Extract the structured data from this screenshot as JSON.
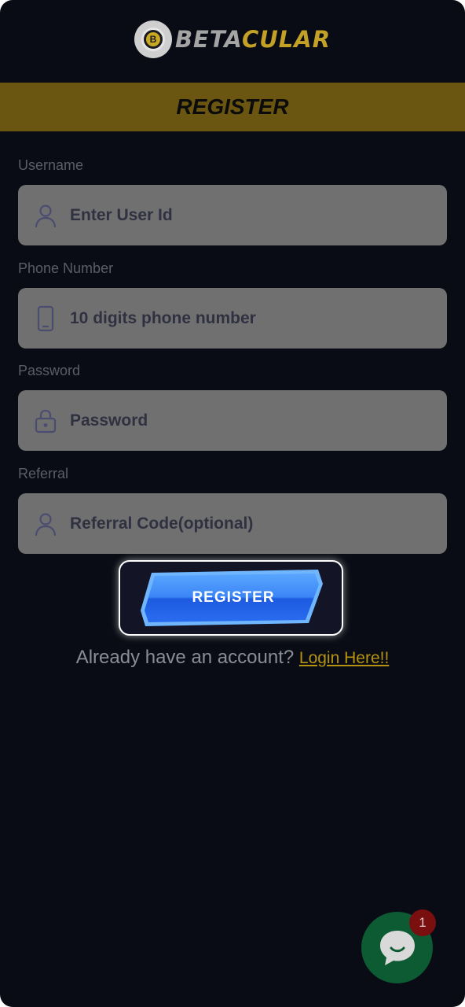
{
  "brand": {
    "name_part1": "BETA",
    "name_part2": "CULAR",
    "logo_letter": "B"
  },
  "header": {
    "title": "REGISTER"
  },
  "form": {
    "username": {
      "label": "Username",
      "placeholder": "Enter User Id",
      "value": ""
    },
    "phone": {
      "label": "Phone Number",
      "placeholder": "10 digits phone number",
      "value": ""
    },
    "password": {
      "label": "Password",
      "placeholder": "Password",
      "value": ""
    },
    "referral": {
      "label": "Referral",
      "placeholder": "Referral Code(optional)",
      "value": ""
    },
    "submit_label": "REGISTER"
  },
  "login_prompt": {
    "text": "Already have an account? ",
    "link": "Login Here!!"
  },
  "chat": {
    "icon": "chat-bubble-icon",
    "unread_count": "1"
  },
  "colors": {
    "background": "#0a0c15",
    "banner": "#6b5611",
    "accent_gold": "#b5930f",
    "button_blue": "#2c6bf0",
    "chat_green": "#0c5b33",
    "badge_red": "#7a0f10"
  }
}
